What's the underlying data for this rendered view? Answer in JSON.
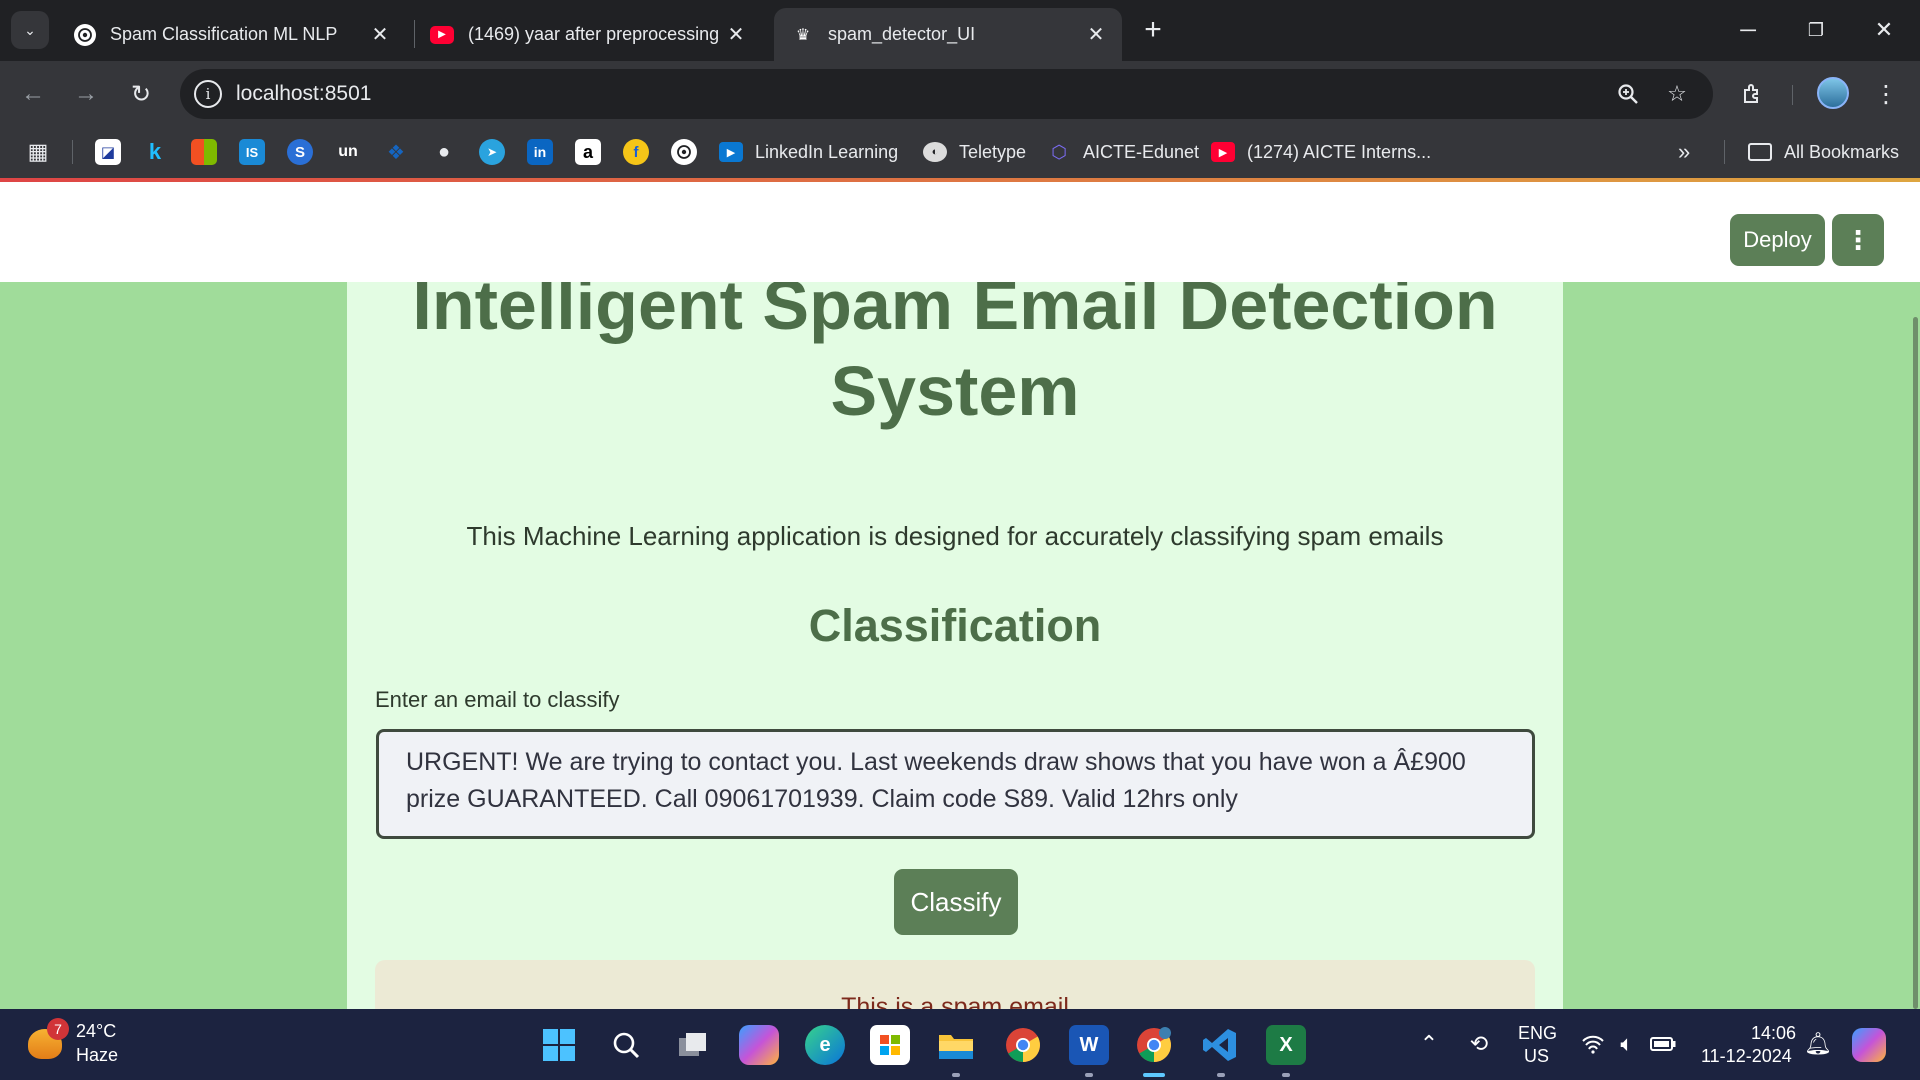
{
  "browser": {
    "tabs": [
      {
        "title": "Spam Classification ML NLP",
        "favicon": "chatgpt-icon",
        "active": false
      },
      {
        "title": "(1469) yaar after preprocessing",
        "favicon": "youtube-icon",
        "active": false
      },
      {
        "title": "spam_detector_UI",
        "favicon": "streamlit-icon",
        "active": true
      }
    ],
    "new_tab_label": "+",
    "url": "localhost:8501",
    "bookmarks": [
      {
        "label": "LinkedIn Learning",
        "icon": "linkedin-learning-icon"
      },
      {
        "label": "Teletype",
        "icon": "teletype-icon"
      },
      {
        "label": "AICTE-Edunet",
        "icon": "aicte-icon"
      },
      {
        "label": "(1274) AICTE Interns...",
        "icon": "youtube-icon"
      }
    ],
    "bookmark_icon_labels": {
      "kaggle": "k",
      "is": "IS",
      "un": "un",
      "linkedin": "in",
      "amazon": "a"
    },
    "all_bookmarks": "All Bookmarks",
    "overflow_label": "»"
  },
  "app": {
    "deploy_label": "Deploy",
    "menu_label": "⋮",
    "title_line1": "Intelligent Spam Email Detection",
    "title_line2": "System",
    "subtitle": "This Machine Learning application is designed for accurately classifying spam emails",
    "section_heading": "Classification",
    "input_label": "Enter an email to classify",
    "input_value": "URGENT! We are trying to contact you. Last weekends draw shows that you have won a Â£900 prize GUARANTEED. Call 09061701939. Claim code S89. Valid 12hrs only",
    "classify_label": "Classify",
    "result_text": "This is a spam email",
    "colors": {
      "page_bg": "#a0dc9a",
      "card_bg": "#e3fce3",
      "primary": "#5c7f57",
      "result_text": "#7d2a1c"
    }
  },
  "taskbar": {
    "weather_temp": "24°C",
    "weather_desc": "Haze",
    "weather_badge": "7",
    "lang_line1": "ENG",
    "lang_line2": "US",
    "time": "14:06",
    "date": "11-12-2024"
  }
}
